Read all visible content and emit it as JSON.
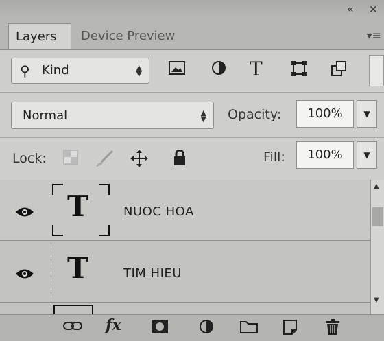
{
  "window": {
    "collapse_icon": "«",
    "close_icon": "×"
  },
  "tabs": [
    {
      "label": "Layers",
      "active": true
    },
    {
      "label": "Device Preview",
      "active": false
    }
  ],
  "panel_menu_icon": "▾≡",
  "filter": {
    "kind_label": "Kind",
    "icons": [
      "image-filter-icon",
      "adjustment-filter-icon",
      "type-filter-icon",
      "shape-filter-icon",
      "smart-object-filter-icon"
    ],
    "type_glyph": "T"
  },
  "blend": {
    "mode": "Normal",
    "opacity_label": "Opacity:",
    "opacity_value": "100%"
  },
  "lock": {
    "label": "Lock:",
    "fill_label": "Fill:",
    "fill_value": "100%"
  },
  "layers": [
    {
      "name": "NUOC HOA",
      "type_glyph": "T",
      "visible": true,
      "selected": true
    },
    {
      "name": "TIM HIEU",
      "type_glyph": "T",
      "visible": true,
      "selected": false
    }
  ],
  "bottom_bar": {
    "fx_label": "fx"
  }
}
